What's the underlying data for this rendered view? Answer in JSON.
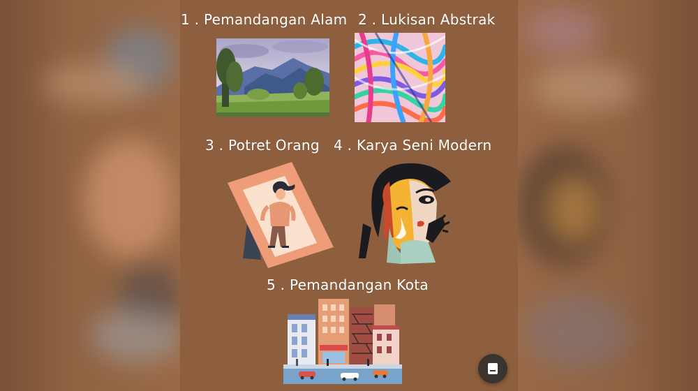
{
  "items": [
    {
      "number": "1",
      "title": "1 . Pemandangan Alam"
    },
    {
      "number": "2",
      "title": "2 . Lukisan Abstrak"
    },
    {
      "number": "3",
      "title": "3 . Potret Orang"
    },
    {
      "number": "4",
      "title": "4 . Karya Seni Modern"
    },
    {
      "number": "5",
      "title": "5 . Pemandangan Kota"
    }
  ],
  "colors": {
    "background": "#8d5f3e",
    "text": "#ffffff",
    "button": "#3a332e"
  },
  "icons": {
    "floating_button": "document-icon"
  }
}
